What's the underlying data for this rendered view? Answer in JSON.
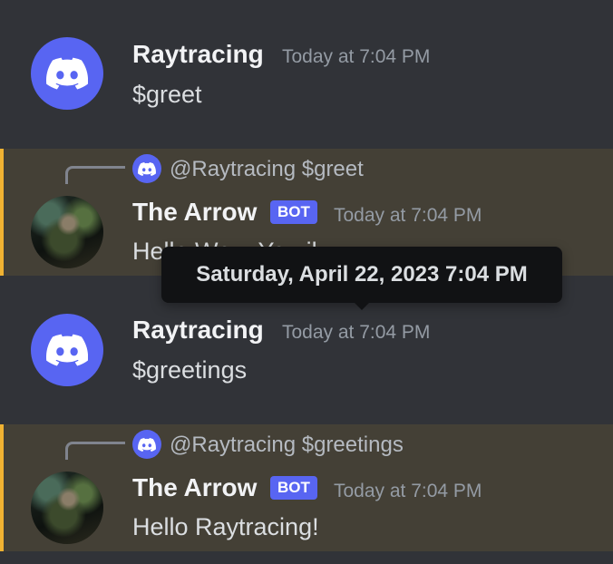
{
  "messages": [
    {
      "author": "Raytracing",
      "timestamp": "Today at 7:04 PM",
      "content": "$greet"
    },
    {
      "author": "The Arrow",
      "bot_tag": "BOT",
      "timestamp": "Today at 7:04 PM",
      "content": "Hello Wo... Yo...il...",
      "reply": {
        "text": "@Raytracing $greet"
      }
    },
    {
      "author": "Raytracing",
      "timestamp": "Today at 7:04 PM",
      "content": "$greetings"
    },
    {
      "author": "The Arrow",
      "bot_tag": "BOT",
      "timestamp": "Today at 7:04 PM",
      "content": "Hello Raytracing!",
      "reply": {
        "text": "@Raytracing $greetings"
      }
    }
  ],
  "tooltip": {
    "text": "Saturday, April 22, 2023 7:04 PM"
  },
  "icons": {
    "discord_avatar": "discord-logo-icon",
    "bot_avatar": "green-arrow-avatar"
  },
  "colors": {
    "background": "#313338",
    "highlight": "#444036",
    "highlight_bar": "#f0b232",
    "blurple": "#5865f2"
  }
}
